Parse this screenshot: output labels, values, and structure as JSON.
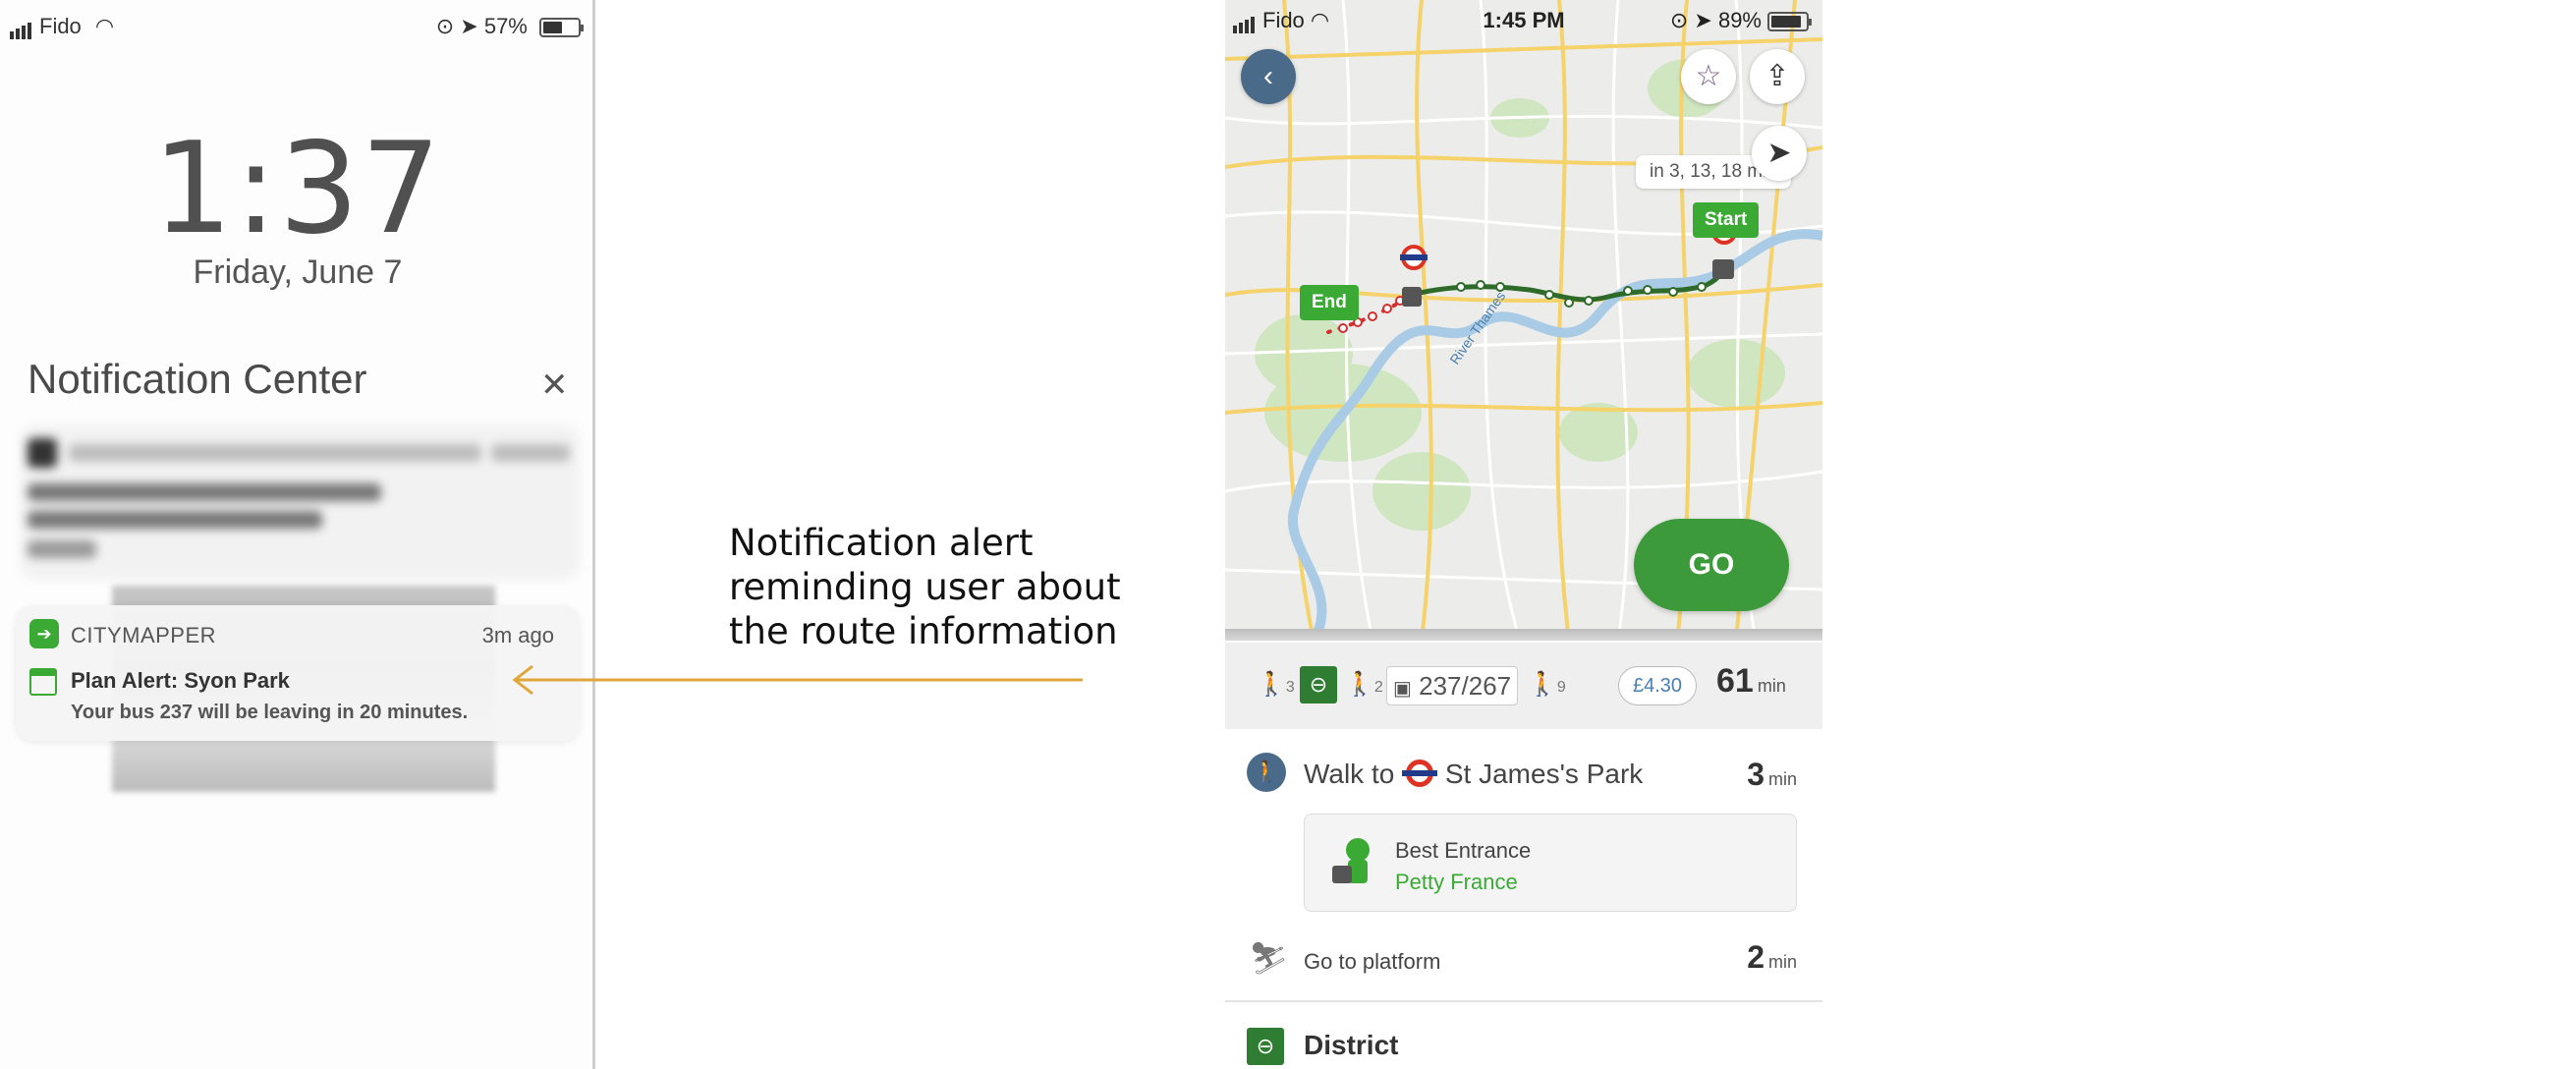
{
  "lock_screen": {
    "carrier": "Fido",
    "battery": "57%",
    "battery_level": 0.57,
    "time": "1:37",
    "date": "Friday, June 7",
    "notification_center_title": "Notification Center",
    "close_glyph": "✕",
    "notification": {
      "app": "CITYMAPPER",
      "when": "3m ago",
      "title": "Plan Alert: Syon Park",
      "body": "Your bus 237 will be leaving in 20 minutes."
    }
  },
  "annotation": {
    "line1": "Notification alert",
    "line2": "reminding user about",
    "line3": "the route information"
  },
  "citymapper": {
    "status": {
      "carrier": "Fido",
      "time": "1:45 PM",
      "battery": "89%",
      "battery_level": 0.89
    },
    "map": {
      "eta_chip": "in 3, 13, 18 min",
      "start_label": "Start",
      "end_label": "End",
      "river_label": "River Thames",
      "go_label": "GO"
    },
    "summary": {
      "walk1": "3",
      "walk2": "2",
      "bus": "237/267",
      "walk3": "9",
      "fare": "£4.30",
      "total_minutes": "61",
      "min_unit": "min"
    },
    "steps": {
      "walk_to_prefix": "Walk to",
      "walk_to_station": "St James's Park",
      "walk_minutes": "3",
      "best_entrance_label": "Best Entrance",
      "best_entrance_value": "Petty France",
      "platform_label": "Go to platform",
      "platform_minutes": "2",
      "line_name": "District"
    },
    "colors": {
      "brand_green": "#3aaa35",
      "route_green": "#2e6b2a",
      "route_red": "#d32f2f"
    }
  }
}
